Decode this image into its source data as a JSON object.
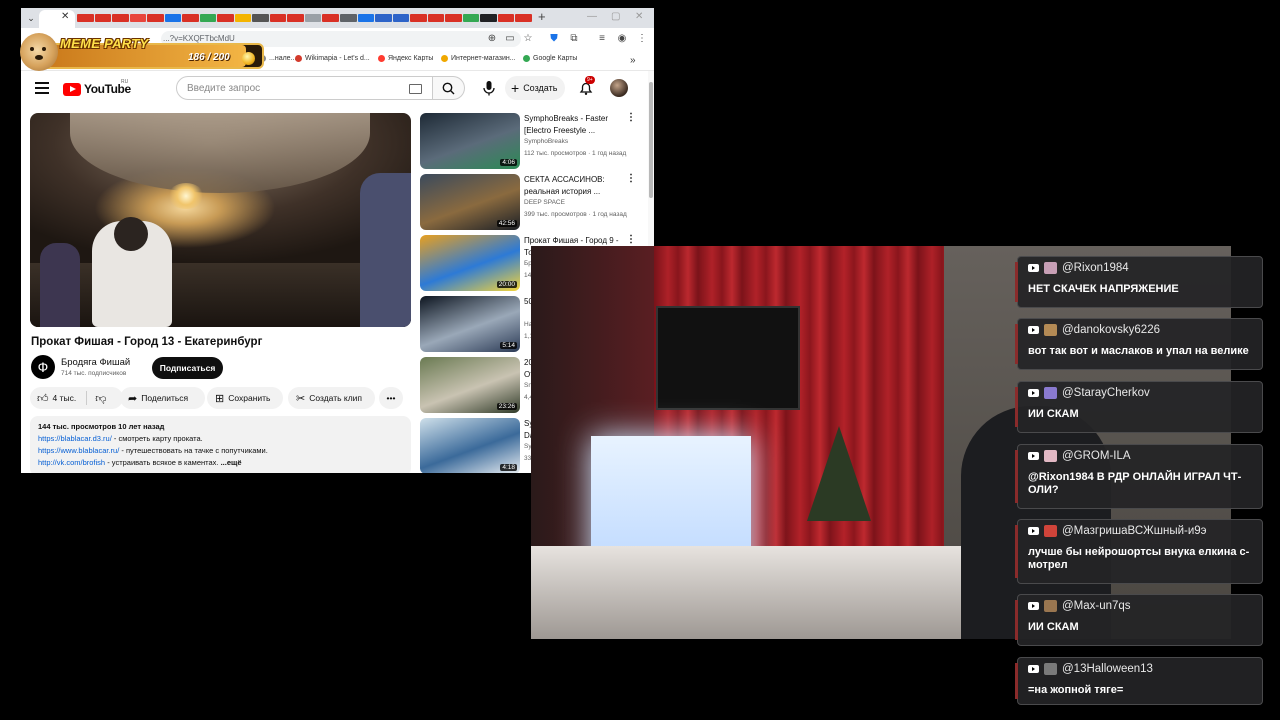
{
  "browser": {
    "omnibox_url": "...?v=KXQFTbcMdU",
    "bookmarks": [
      {
        "label": "...нале...",
        "color": "#888888"
      },
      {
        "label": "Wikimapia - Let's d...",
        "color": "#d33b2d"
      },
      {
        "label": "Яндекс Карты",
        "color": "#ff3b30"
      },
      {
        "label": "Интернет-магазин...",
        "color": "#f0a800"
      },
      {
        "label": "Google Карты",
        "color": "#34a853"
      }
    ],
    "tab_favicon_colors": [
      "#d93025",
      "#d93025",
      "#d93025",
      "#e8453c",
      "#d93025",
      "#1a73e8",
      "#d93025",
      "#34a853",
      "#d93025",
      "#f4b400",
      "#555555",
      "#d93025",
      "#d93025",
      "#9aa0a6",
      "#d93025",
      "#5f6368",
      "#1a73e8",
      "#2d63c8",
      "#2d63c8",
      "#d93025",
      "#d93025",
      "#d93025",
      "#34a853",
      "#202124",
      "#d93025",
      "#d93025"
    ]
  },
  "meme_party": {
    "title": "MEME PARTY",
    "count": "186 / 200"
  },
  "youtube": {
    "logo": "YouTube",
    "region": "RU",
    "search_placeholder": "Введите запрос",
    "create_label": "Создать",
    "notifications_badge": "9+",
    "video": {
      "title": "Прокат Фишая - Город 13 - Екатеринбург",
      "channel": "Бродяга Фишай",
      "channel_initial": "Ф",
      "subscribers": "714 тыс. подписчиков",
      "subscribe_label": "Подписаться",
      "likes": "4 тыс.",
      "share_label": "Поделиться",
      "save_label": "Сохранить",
      "clip_label": "Создать клип",
      "description": {
        "meta": "144 тыс. просмотров  10 лет назад",
        "line1_link": "https://blablacar.d3.ru/",
        "line1_text": " - смотреть карту проката.",
        "line2_link": "https://www.blablacar.ru/",
        "line2_text": " - путешествовать на тачке с попутчиками.",
        "line3_link": "http://vk.com/brofish",
        "line3_text": " - устраивать всякое в каментах. ",
        "more": "...ещё"
      }
    },
    "recommendations": [
      {
        "title": "SymphoBreaks - Faster [Electro Freestyle ...",
        "channel": "SymphoBreaks",
        "stats": "112 тыс. просмотров · 1 год назад",
        "duration": "4:06",
        "colors": [
          "#1e2a36",
          "#5b6b7a",
          "#2c8a55"
        ]
      },
      {
        "title": "СЕКТА АССАСИНОВ: реальная история ...",
        "channel": "DEEP SPACE",
        "stats": "399 тыс. просмотров · 1 год назад",
        "duration": "42:56",
        "colors": [
          "#3b4a5c",
          "#8a6a3f",
          "#1b1f26"
        ]
      },
      {
        "title": "Прокат Фишая - Город 9 - Томск",
        "channel": "Бродяга Фишай",
        "stats": "144 тыс. просмотров · 10 лет назад",
        "duration": "20:00",
        "colors": [
          "#e8a020",
          "#2d7ad6",
          "#f5d63a"
        ]
      },
      {
        "title": "500hp Evo Night Run | 4K",
        "channel": "Hastnett Media",
        "stats": "1,1 млн просмотров · 2 года назад",
        "duration": "5:14",
        "colors": [
          "#0d1520",
          "#9aa8b8",
          "#2b3a55"
        ]
      },
      {
        "title": "20 лет одиночества. Откровения ...",
        "channel": "Sneg Media",
        "stats": "4,4 млн просмотров · 2 года назад",
        "duration": "23:26",
        "colors": [
          "#6a7a52",
          "#c9c3b2",
          "#2f3a28"
        ]
      },
      {
        "title": "SymphoBreaks - On The Dance Floor [Electro ...",
        "channel": "SymphoBreaks",
        "stats": "330 тыс. просмотров · 2 года назад",
        "duration": "4:18",
        "colors": [
          "#cfe0ea",
          "#3b6a9a",
          "#e9eef2"
        ]
      }
    ]
  },
  "chat": [
    {
      "user": "@Rixon1984",
      "text": "НЕТ СКАЧЕК НАПРЯЖЕНИЕ",
      "avatar_color": "#c79fb5"
    },
    {
      "user": "@danokovsky6226",
      "text": "вот так вот и маслаков и упал на велике",
      "avatar_color": "#b48a55"
    },
    {
      "user": "@StarayCherkov",
      "text": "ИИ СКАМ",
      "avatar_color": "#8a7ad0"
    },
    {
      "user": "@GROM-ILA",
      "text": "@Rixon1984 В РДР ОНЛАЙН ИГРАЛ ЧТ-ОЛИ?",
      "avatar_color": "#e2b8c4"
    },
    {
      "user": "@МазгришаВСЖшный-и9э",
      "text": "лучше бы нейрошортсы внука елкина с-мотрел",
      "avatar_color": "#d0443a"
    },
    {
      "user": "@Max-un7qs",
      "text": "ИИ СКАМ",
      "avatar_color": "#9a7650"
    },
    {
      "user": "@13Halloween13",
      "text": "=на жопной тяге=",
      "avatar_color": "#7a7a7a"
    }
  ]
}
